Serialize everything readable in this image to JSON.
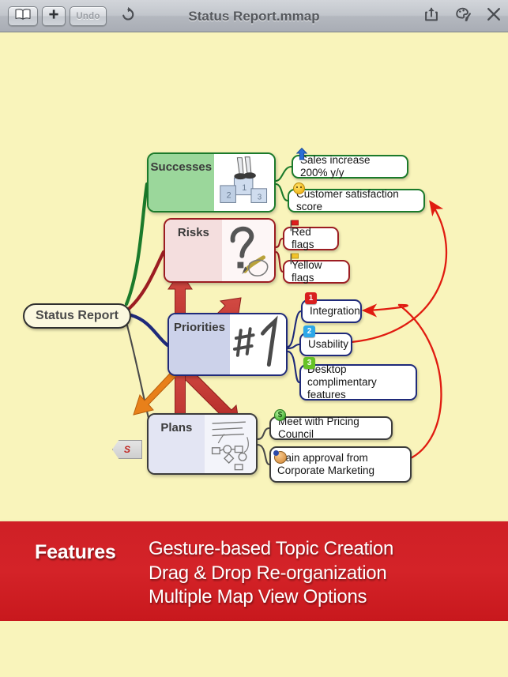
{
  "toolbar": {
    "title": "Status Report.mmap",
    "library_icon": "book-icon",
    "add_label": "+",
    "undo_label": "Undo",
    "redo_icon": "redo-arrow-icon",
    "share_icon": "share-icon",
    "style_icon": "brush-palette-icon",
    "close_icon": "close-icon"
  },
  "map": {
    "root": {
      "label": "Status Report"
    },
    "branches": [
      {
        "label": "Successes",
        "color": "#1b7a2b",
        "art": "podium-winner-sketch",
        "subtopics": [
          {
            "label": "Sales increase 200% y/y",
            "icon": "blue-up-arrow-icon"
          },
          {
            "label": "Customer satisfaction score",
            "icon": "smiley-face-icon"
          }
        ]
      },
      {
        "label": "Risks",
        "color": "#9c1d22",
        "art": "question-mark-pencil-sketch",
        "subtopics": [
          {
            "label": "Red flags",
            "icon": "red-flag-icon"
          },
          {
            "label": "Yellow flags",
            "icon": "yellow-flag-icon"
          }
        ]
      },
      {
        "label": "Priorities",
        "color": "#1f2a7a",
        "art": "number-one-sketch",
        "subtopics": [
          {
            "label": "Integration",
            "icon": "number-badge-1",
            "badge": "1"
          },
          {
            "label": "Usability",
            "icon": "number-badge-2",
            "badge": "2"
          },
          {
            "label": "Desktop complimentary features",
            "icon": "number-badge-3",
            "badge": "3"
          }
        ]
      },
      {
        "label": "Plans",
        "color": "#3c3c3c",
        "art": "checklist-flowchart-sketch",
        "subtopics": [
          {
            "label": "Meet with Pricing Council",
            "icon": "green-dollar-icon"
          },
          {
            "label": "Gain approval from Corporate Marketing",
            "icon": "person-face-icon"
          }
        ]
      }
    ],
    "marker": {
      "label": "S",
      "shape": "pentagon-tag"
    },
    "colors": {
      "canvas_background": "#f9f4bb",
      "successes": "#1b7a2b",
      "risks": "#9c1d22",
      "priorities": "#1f2a7a",
      "plans": "#3c3c3c",
      "relationship_line": "#e01b10",
      "callout_arrow": "#c2352f",
      "marker_arrow": "#e8801a"
    }
  },
  "banner": {
    "title": "Features",
    "lines": [
      "Gesture-based Topic Creation",
      "Drag & Drop Re-organization",
      "Multiple Map View Options"
    ],
    "background": "#cf2026"
  }
}
